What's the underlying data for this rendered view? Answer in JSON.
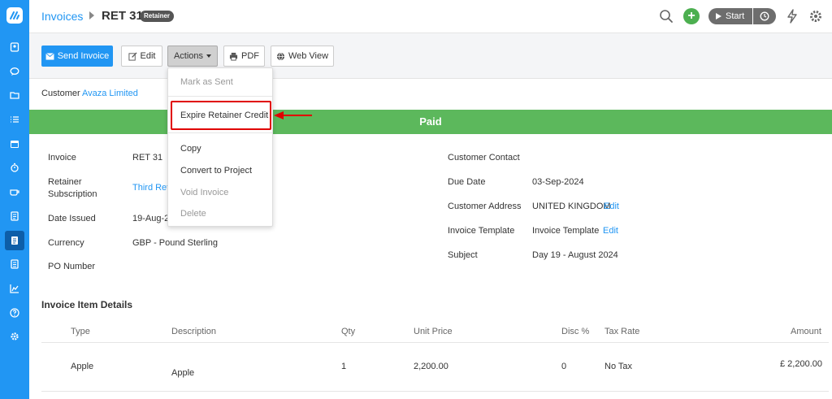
{
  "header": {
    "breadcrumb": "Invoices",
    "title": "RET 31",
    "badge": "Retainer",
    "start_label": "Start"
  },
  "toolbar": {
    "send_invoice": "Send Invoice",
    "edit": "Edit",
    "actions": "Actions",
    "pdf": "PDF",
    "web_view": "Web View"
  },
  "customer": {
    "label": "Customer",
    "name": "Avaza Limited"
  },
  "status_banner": "Paid",
  "details_left": [
    {
      "label": "Invoice",
      "value": "RET 31"
    },
    {
      "label": "Retainer",
      "label2": "Subscription",
      "value": "Third Ret"
    },
    {
      "label": "Date Issued",
      "value": "19-Aug-20"
    },
    {
      "label": "Currency",
      "value": "GBP - Pound Sterling"
    },
    {
      "label": "PO Number",
      "value": ""
    }
  ],
  "details_right": [
    {
      "label": "Customer Contact",
      "value": ""
    },
    {
      "label": "Due Date",
      "value": "03-Sep-2024"
    },
    {
      "label": "Customer Address",
      "value": "UNITED KINGDOM",
      "link": "Edit"
    },
    {
      "label": "Invoice Template",
      "value": "Invoice Template",
      "link": "Edit"
    },
    {
      "label": "Subject",
      "value": "Day 19 - August 2024"
    }
  ],
  "items": {
    "title": "Invoice Item Details",
    "columns": [
      "Type",
      "Description",
      "Qty",
      "Unit Price",
      "Disc %",
      "Tax Rate",
      "Amount"
    ],
    "rows": [
      {
        "type": "Apple",
        "description": "Apple",
        "qty": "1",
        "unit_price": "2,200.00",
        "disc": "0",
        "tax_rate": "No Tax",
        "amount": "£ 2,200.00"
      }
    ]
  },
  "actions_menu": [
    {
      "label": "Mark as Sent",
      "enabled": false
    },
    {
      "label": "Expire Retainer Credit",
      "enabled": true
    },
    {
      "label": "Copy",
      "enabled": true
    },
    {
      "label": "Convert to Project",
      "enabled": true
    },
    {
      "label": "Void Invoice",
      "enabled": false
    },
    {
      "label": "Delete",
      "enabled": false
    }
  ],
  "colors": {
    "primary": "#2196F3",
    "paid": "#5cb85c",
    "annotation": "#e00000"
  },
  "sidebar_icons": [
    "logo-icon",
    "contacts-icon",
    "chat-icon",
    "folder-icon",
    "tasks-icon",
    "calendar-icon",
    "timer-icon",
    "expenses-icon",
    "estimates-icon",
    "invoices-icon",
    "bills-icon",
    "reports-icon",
    "help-icon",
    "settings-icon"
  ]
}
